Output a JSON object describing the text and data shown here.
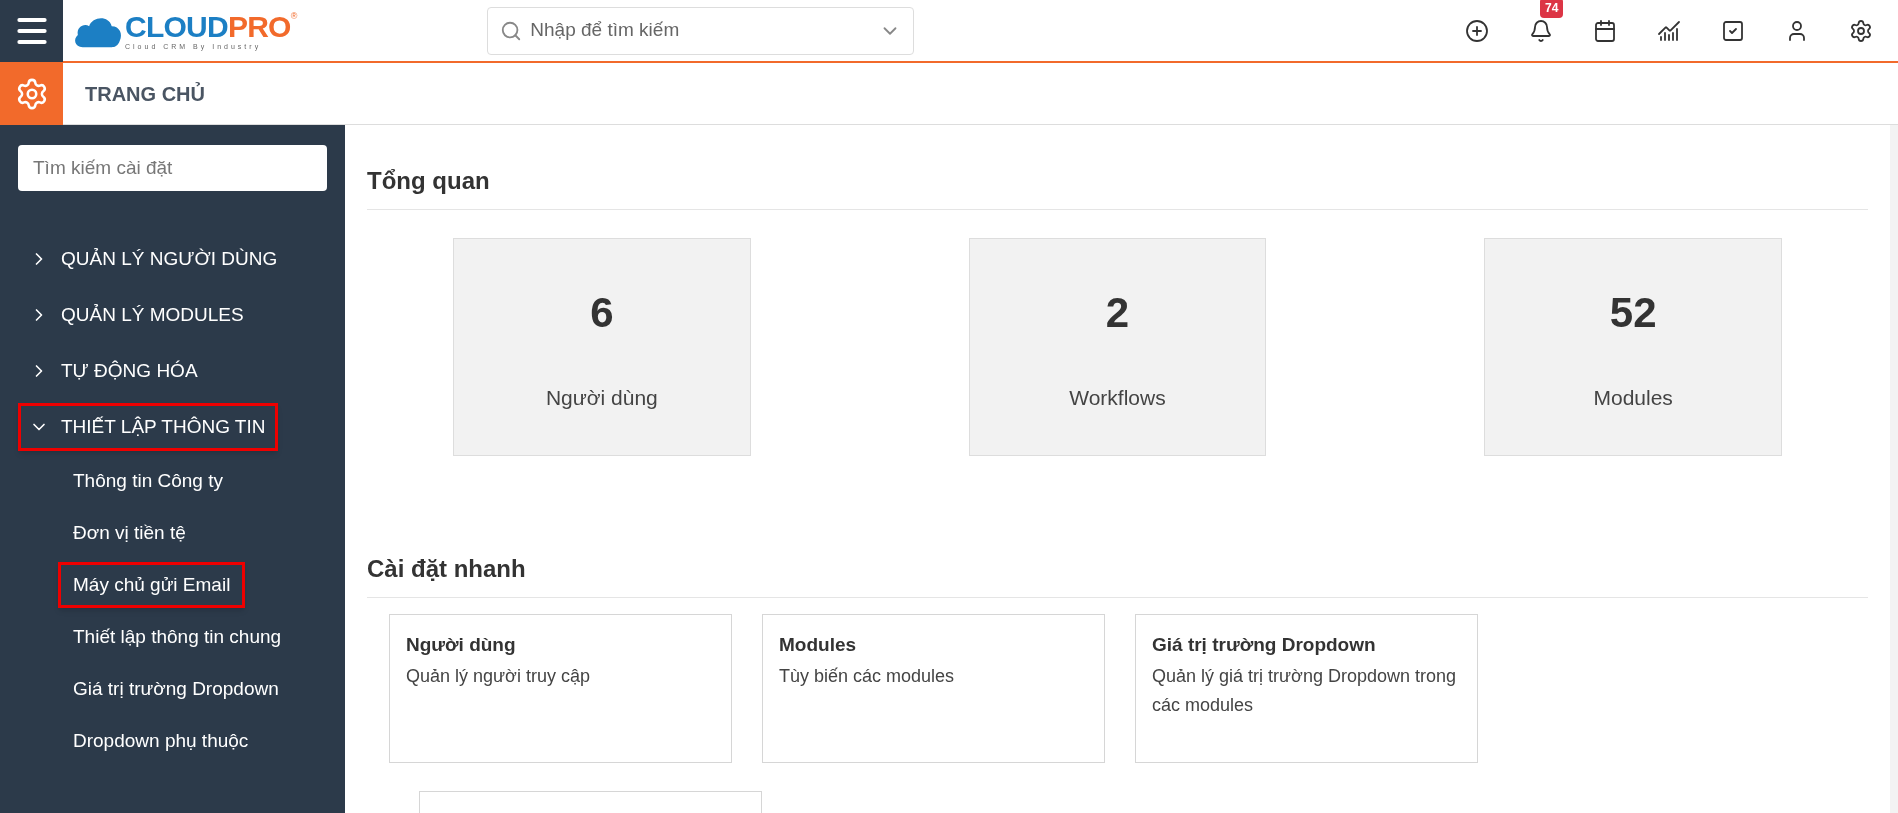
{
  "logo": {
    "word_1": "CLOUD",
    "word_2": "PRO",
    "mark": "®",
    "tagline": "Cloud CRM By Industry"
  },
  "search": {
    "placeholder": "Nhập để tìm kiếm"
  },
  "notifications": {
    "count": "74"
  },
  "breadcrumb": {
    "title": "TRANG CHỦ"
  },
  "sidebar": {
    "search": {
      "placeholder": "Tìm kiếm cài đặt"
    },
    "items": [
      {
        "label": "QUẢN LÝ NGƯỜI DÙNG",
        "expanded": false,
        "highlighted": false
      },
      {
        "label": "QUẢN LÝ MODULES",
        "expanded": false,
        "highlighted": false
      },
      {
        "label": "TỰ ĐỘNG HÓA",
        "expanded": false,
        "highlighted": false
      },
      {
        "label": "THIẾT LẬP THÔNG TIN",
        "expanded": true,
        "highlighted": true,
        "children": [
          {
            "label": "Thông tin Công ty",
            "highlighted": false
          },
          {
            "label": "Đơn vị tiền tệ",
            "highlighted": false
          },
          {
            "label": "Máy chủ gửi Email",
            "highlighted": true
          },
          {
            "label": "Thiết lập thông tin chung",
            "highlighted": false
          },
          {
            "label": "Giá trị trường Dropdown",
            "highlighted": false
          },
          {
            "label": "Dropdown phụ thuộc",
            "highlighted": false
          }
        ]
      }
    ]
  },
  "overview": {
    "title": "Tổng quan",
    "stats": [
      {
        "value": "6",
        "label": "Người dùng"
      },
      {
        "value": "2",
        "label": "Workflows"
      },
      {
        "value": "52",
        "label": "Modules"
      }
    ]
  },
  "quick_settings": {
    "title": "Cài đặt nhanh",
    "cards": [
      {
        "title": "Người dùng",
        "description": "Quản lý người truy cập"
      },
      {
        "title": "Modules",
        "description": "Tùy biến các modules"
      },
      {
        "title": "Giá trị trường Dropdown",
        "description": "Quản lý giá trị trường Dropdown trong các modules"
      }
    ]
  }
}
